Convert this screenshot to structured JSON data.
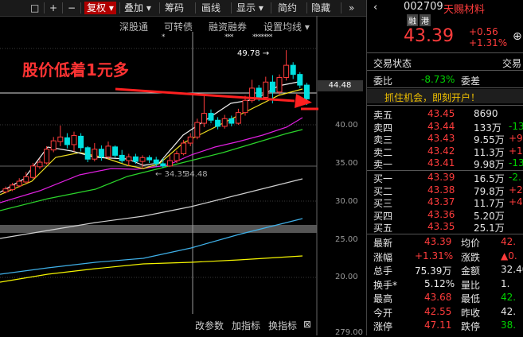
{
  "toolbar": {
    "items": [
      "□",
      "+",
      "−",
      "复权",
      "叠加",
      "筹码",
      "画线",
      "显示",
      "简约",
      "隐藏",
      "»"
    ],
    "dropdown": "▾"
  },
  "subtabs": [
    "深股通",
    "可转债",
    "融资融券",
    "设置均线"
  ],
  "stars": [
    "*",
    "***",
    "*******"
  ],
  "annotation": "股价低着1元多",
  "high_label": "49.78",
  "low_label": "34.35",
  "low_label2": "34.48",
  "price_tag": "44.48",
  "yticks": [
    "40.00",
    "35.00",
    "30.00",
    "25.00",
    "20.00",
    "279.00"
  ],
  "bottom_tools": [
    "改参数",
    "加指标",
    "换指标",
    "⊠"
  ],
  "stock": {
    "code": "002709",
    "name": "天赐材料",
    "badge1": "融",
    "badge2": "港",
    "price": "43.39",
    "change": "+0.56",
    "pct": "+1.31%"
  },
  "section_title": "交易状态",
  "section_title2": "交易",
  "webi": {
    "label": "委比",
    "value": "-8.73%",
    "label2": "委差"
  },
  "banner": "抓住机会，即刻开户！",
  "asks": [
    {
      "label": "卖五",
      "price": "43.45",
      "vol": "8690",
      "extra": ""
    },
    {
      "label": "卖四",
      "price": "43.44",
      "vol": "133万",
      "extra": "-13."
    },
    {
      "label": "卖三",
      "price": "43.43",
      "vol": "9.55万",
      "extra": "+9."
    },
    {
      "label": "卖二",
      "price": "43.42",
      "vol": "11.3万",
      "extra": "+10"
    },
    {
      "label": "卖一",
      "price": "43.41",
      "vol": "9.98万",
      "extra": "-13."
    }
  ],
  "bids": [
    {
      "label": "买一",
      "price": "43.39",
      "vol": "16.5万",
      "extra": "-2."
    },
    {
      "label": "买二",
      "price": "43.38",
      "vol": "79.8万",
      "extra": "+27."
    },
    {
      "label": "买三",
      "price": "43.37",
      "vol": "11.7万",
      "extra": "+4."
    },
    {
      "label": "买四",
      "price": "43.36",
      "vol": "5.20万",
      "extra": ""
    },
    {
      "label": "买五",
      "price": "43.35",
      "vol": "25.1万",
      "extra": ""
    }
  ],
  "stats": [
    {
      "l1": "最新",
      "v1": "43.39",
      "l2": "均价",
      "v2": "42."
    },
    {
      "l1": "涨幅",
      "v1": "+1.31%",
      "l2": "涨跌",
      "v2": "▲0."
    },
    {
      "l1": "总手",
      "v1": "75.39万",
      "l2": "金额",
      "v2": "32.40"
    },
    {
      "l1": "换手*",
      "v1": "5.12%",
      "l2": "量比",
      "v2": "1."
    },
    {
      "l1": "最高",
      "v1": "43.68",
      "l2": "最低",
      "v2": "42."
    },
    {
      "l1": "今开",
      "v1": "42.55",
      "l2": "昨收",
      "v2": "42."
    },
    {
      "l1": "涨停",
      "v1": "47.11",
      "l2": "跌停",
      "v2": "38."
    }
  ]
}
